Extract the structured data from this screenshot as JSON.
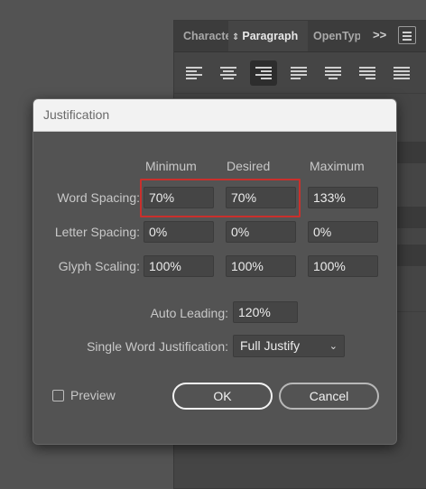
{
  "panel": {
    "tabs": [
      "Characte",
      "Paragraph",
      "OpenTyp"
    ],
    "overflow_label": ">>",
    "menu_icon": "hamburger-menu-icon",
    "alignment_buttons": [
      "align-left-icon",
      "align-center-icon",
      "align-right-icon",
      "justify-last-left-icon",
      "justify-last-center-icon",
      "justify-last-right-icon",
      "justify-all-icon"
    ]
  },
  "dialog": {
    "title": "Justification",
    "columns": [
      "Minimum",
      "Desired",
      "Maximum"
    ],
    "rows": [
      {
        "label": "Word Spacing:",
        "values": [
          "70%",
          "70%",
          "133%"
        ]
      },
      {
        "label": "Letter Spacing:",
        "values": [
          "0%",
          "0%",
          "0%"
        ]
      },
      {
        "label": "Glyph Scaling:",
        "values": [
          "100%",
          "100%",
          "100%"
        ]
      }
    ],
    "auto_leading": {
      "label": "Auto Leading:",
      "value": "120%"
    },
    "single_word": {
      "label": "Single Word Justification:",
      "value": "Full Justify"
    },
    "preview": {
      "label": "Preview",
      "checked": false
    },
    "buttons": {
      "ok": "OK",
      "cancel": "Cancel"
    }
  },
  "colors": {
    "highlight": "#c9302c",
    "dialog_bg": "#535353",
    "field_bg": "#454545"
  }
}
